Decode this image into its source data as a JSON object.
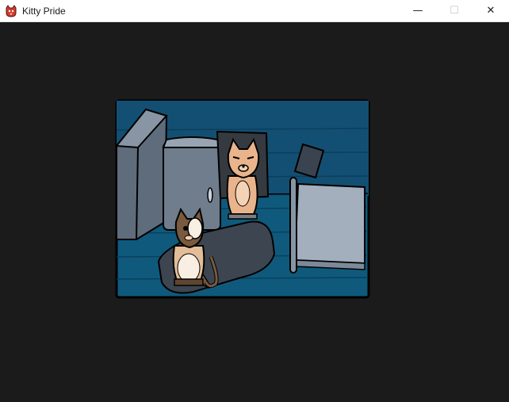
{
  "window": {
    "title": "Kitty Pride",
    "icon": "cat-head-icon",
    "controls": {
      "minimize": "—",
      "maximize": "☐",
      "close": "✕"
    }
  },
  "scene": {
    "description_icon": "bedroom-scene",
    "colors": {
      "background": "#1b1b1b",
      "floor": "#0f5a7c",
      "wall": "#134f72",
      "furniture": "#6f7d8c",
      "rug": "#3c4550",
      "bed": "#a3afbd",
      "orange_cat": "#e9b48c",
      "siamese_cat": "#7a5a3e"
    }
  }
}
